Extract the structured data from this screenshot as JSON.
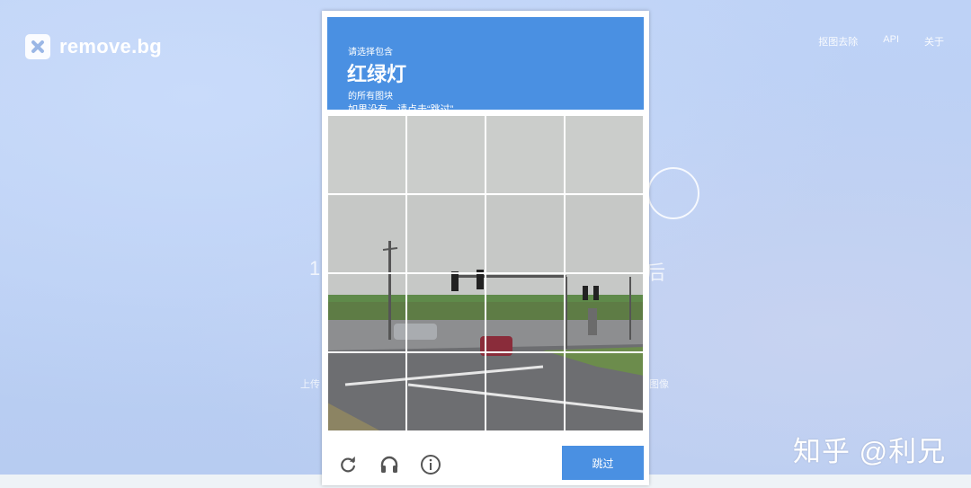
{
  "site": {
    "logo_text": "remove.bg",
    "nav": [
      "抠图去除",
      "API",
      "关于"
    ],
    "hero_left_fragment": "1",
    "hero_right_fragment": "后",
    "hero_sub_left": "上传",
    "hero_sub_right": "图像"
  },
  "captcha": {
    "instruction_small": "请选择包含",
    "target_object": "红绿灯",
    "instruction_line3": "的所有图块",
    "instruction_line4": "如果没有，请点击“跳过”。",
    "grid": {
      "rows": 4,
      "cols": 4
    },
    "skip_label": "跳过",
    "icons": [
      "reload-icon",
      "audio-icon",
      "info-icon"
    ]
  },
  "watermark": "知乎 @利兄",
  "colors": {
    "accent": "#4a90e2",
    "background": "#bcd0f4"
  }
}
